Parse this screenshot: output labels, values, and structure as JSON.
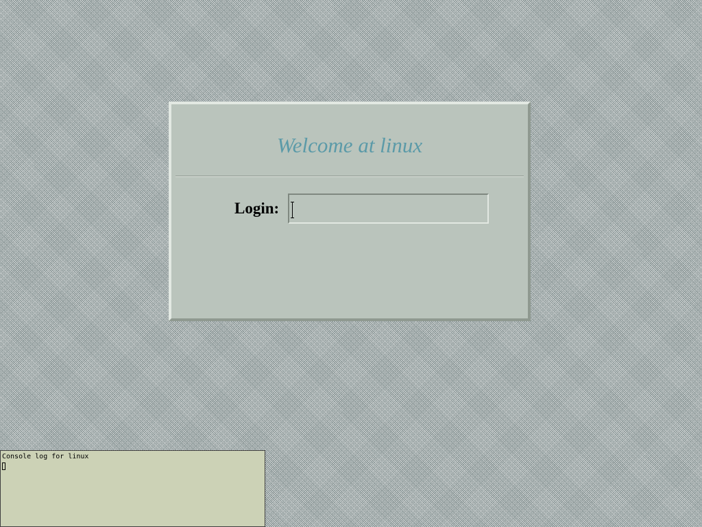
{
  "greeter": {
    "welcome_text": "Welcome at linux",
    "login_label": "Login:",
    "login_value": "",
    "welcome_color": "#5b9aa8",
    "panel_color": "#bac4bc"
  },
  "console": {
    "title": "Console log for linux",
    "background_color": "#ccd2b6"
  }
}
